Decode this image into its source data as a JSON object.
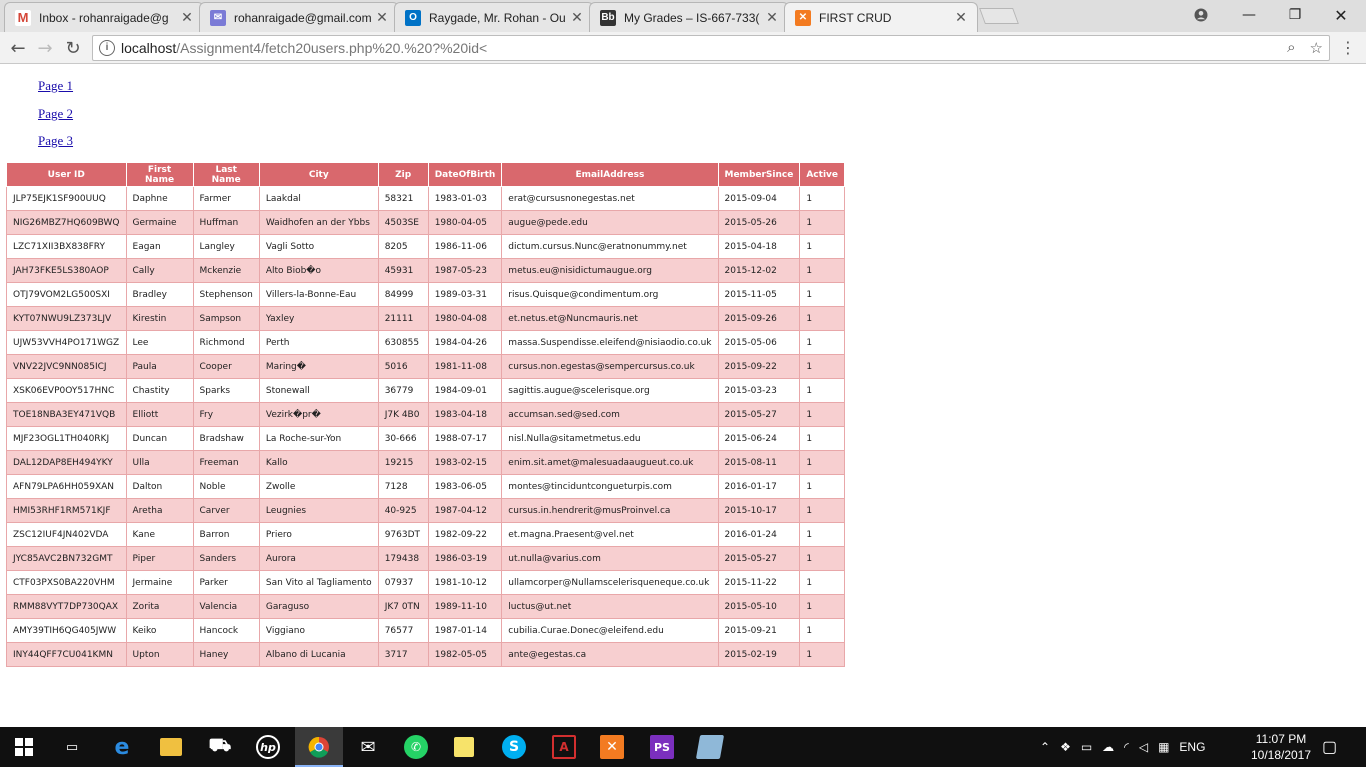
{
  "browser": {
    "tabs": [
      {
        "title": "Inbox - rohanraigade@g",
        "icon": "gmail-icon",
        "color": "#d44638"
      },
      {
        "title": "rohanraigade@gmail.com",
        "icon": "mail-icon",
        "color": "#7b7bd6"
      },
      {
        "title": "Raygade, Mr. Rohan - Ou",
        "icon": "outlook-icon",
        "color": "#0072c6"
      },
      {
        "title": "My Grades – IS-667-733(",
        "icon": "blackboard-icon",
        "color": "#333333"
      },
      {
        "title": "FIRST CRUD",
        "icon": "xampp-icon",
        "color": "#f37b21"
      }
    ],
    "url_host": "localhost",
    "url_path": "/Assignment4/fetch20users.php%20.%20?%20id<"
  },
  "page": {
    "links": [
      "Page 1",
      "Page 2",
      "Page 3"
    ]
  },
  "table": {
    "headers": [
      "User ID",
      "First Name",
      "Last Name",
      "City",
      "Zip",
      "DateOfBirth",
      "EmailAddress",
      "MemberSince",
      "Active"
    ],
    "rows": [
      [
        "JLP75EJK1SF900UUQ",
        "Daphne",
        "Farmer",
        "Laakdal",
        "58321",
        "1983-01-03",
        "erat@cursusnonegestas.net",
        "2015-09-04",
        "1"
      ],
      [
        "NIG26MBZ7HQ609BWQ",
        "Germaine",
        "Huffman",
        "Waidhofen an der Ybbs",
        "4503SE",
        "1980-04-05",
        "augue@pede.edu",
        "2015-05-26",
        "1"
      ],
      [
        "LZC71XII3BX838FRY",
        "Eagan",
        "Langley",
        "Vagli Sotto",
        "8205",
        "1986-11-06",
        "dictum.cursus.Nunc@eratnonummy.net",
        "2015-04-18",
        "1"
      ],
      [
        "JAH73FKE5LS380AOP",
        "Cally",
        "Mckenzie",
        "Alto Biob�o",
        "45931",
        "1987-05-23",
        "metus.eu@nisidictumaugue.org",
        "2015-12-02",
        "1"
      ],
      [
        "OTJ79VOM2LG500SXI",
        "Bradley",
        "Stephenson",
        "Villers-la-Bonne-Eau",
        "84999",
        "1989-03-31",
        "risus.Quisque@condimentum.org",
        "2015-11-05",
        "1"
      ],
      [
        "KYT07NWU9LZ373LJV",
        "Kirestin",
        "Sampson",
        "Yaxley",
        "21111",
        "1980-04-08",
        "et.netus.et@Nuncmauris.net",
        "2015-09-26",
        "1"
      ],
      [
        "UJW53VVH4PO171WGZ",
        "Lee",
        "Richmond",
        "Perth",
        "630855",
        "1984-04-26",
        "massa.Suspendisse.eleifend@nisiaodio.co.uk",
        "2015-05-06",
        "1"
      ],
      [
        "VNV22JVC9NN085ICJ",
        "Paula",
        "Cooper",
        "Maring�",
        "5016",
        "1981-11-08",
        "cursus.non.egestas@sempercursus.co.uk",
        "2015-09-22",
        "1"
      ],
      [
        "XSK06EVP0OY517HNC",
        "Chastity",
        "Sparks",
        "Stonewall",
        "36779",
        "1984-09-01",
        "sagittis.augue@scelerisque.org",
        "2015-03-23",
        "1"
      ],
      [
        "TOE18NBA3EY471VQB",
        "Elliott",
        "Fry",
        "Vezirk�pr�",
        "J7K 4B0",
        "1983-04-18",
        "accumsan.sed@sed.com",
        "2015-05-27",
        "1"
      ],
      [
        "MJF23OGL1TH040RKJ",
        "Duncan",
        "Bradshaw",
        "La Roche-sur-Yon",
        "30-666",
        "1988-07-17",
        "nisl.Nulla@sitametmetus.edu",
        "2015-06-24",
        "1"
      ],
      [
        "DAL12DAP8EH494YKY",
        "Ulla",
        "Freeman",
        "Kallo",
        "19215",
        "1983-02-15",
        "enim.sit.amet@malesuadaaugueut.co.uk",
        "2015-08-11",
        "1"
      ],
      [
        "AFN79LPA6HH059XAN",
        "Dalton",
        "Noble",
        "Zwolle",
        "7128",
        "1983-06-05",
        "montes@tinciduntcongueturpis.com",
        "2016-01-17",
        "1"
      ],
      [
        "HMI53RHF1RM571KJF",
        "Aretha",
        "Carver",
        "Leugnies",
        "40-925",
        "1987-04-12",
        "cursus.in.hendrerit@musProinvel.ca",
        "2015-10-17",
        "1"
      ],
      [
        "ZSC12IUF4JN402VDA",
        "Kane",
        "Barron",
        "Priero",
        "9763DT",
        "1982-09-22",
        "et.magna.Praesent@vel.net",
        "2016-01-24",
        "1"
      ],
      [
        "JYC85AVC2BN732GMT",
        "Piper",
        "Sanders",
        "Aurora",
        "179438",
        "1986-03-19",
        "ut.nulla@varius.com",
        "2015-05-27",
        "1"
      ],
      [
        "CTF03PXS0BA220VHM",
        "Jermaine",
        "Parker",
        "San Vito al Tagliamento",
        "07937",
        "1981-10-12",
        "ullamcorper@Nullamscelerisqueneque.co.uk",
        "2015-11-22",
        "1"
      ],
      [
        "RMM88VYT7DP730QAX",
        "Zorita",
        "Valencia",
        "Garaguso",
        "JK7 0TN",
        "1989-11-10",
        "luctus@ut.net",
        "2015-05-10",
        "1"
      ],
      [
        "AMY39TIH6QG405JWW",
        "Keiko",
        "Hancock",
        "Viggiano",
        "76577",
        "1987-01-14",
        "cubilia.Curae.Donec@eleifend.edu",
        "2015-09-21",
        "1"
      ],
      [
        "INY44QFF7CU041KMN",
        "Upton",
        "Haney",
        "Albano di Lucania",
        "3717",
        "1982-05-05",
        "ante@egestas.ca",
        "2015-02-19",
        "1"
      ]
    ]
  },
  "taskbar": {
    "lang": "ENG",
    "time": "11:07 PM",
    "date": "10/18/2017"
  },
  "colors": {
    "header_bg": "#d9686d",
    "row_alt": "#f7cfd0",
    "link": "#1a0dab"
  }
}
